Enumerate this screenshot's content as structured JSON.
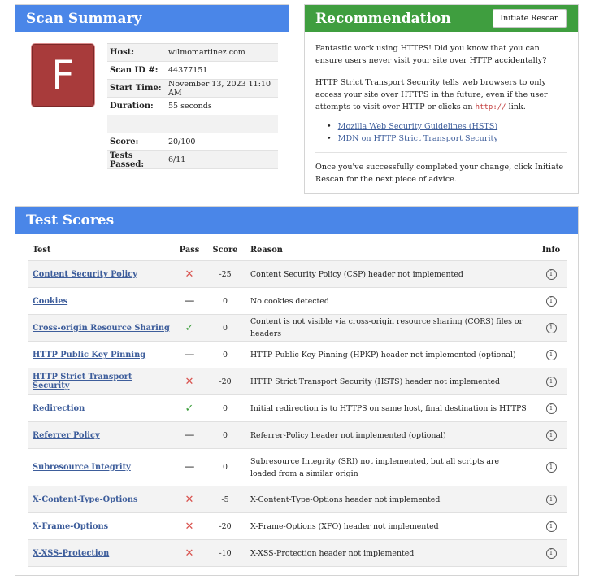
{
  "summary": {
    "title": "Scan Summary",
    "grade": "F",
    "rows": [
      {
        "label": "Host:",
        "value": "wilmomartinez.com"
      },
      {
        "label": "Scan ID #:",
        "value": "44377151"
      },
      {
        "label": "Start Time:",
        "value": "November 13, 2023 11:10 AM"
      },
      {
        "label": "Duration:",
        "value": "55 seconds"
      },
      {
        "label": "",
        "value": ""
      },
      {
        "label": "Score:",
        "value": "20/100"
      },
      {
        "label": "Tests Passed:",
        "value": "6/11"
      }
    ]
  },
  "recommendation": {
    "title": "Recommendation",
    "rescan_label": "Initiate Rescan",
    "p1": "Fantastic work using HTTPS! Did you know that you can ensure users never visit your site over HTTP accidentally?",
    "p2_before": "HTTP Strict Transport Security tells web browsers to only access your site over HTTPS in the future, even if the user attempts to visit over HTTP or clicks an ",
    "p2_code": "http://",
    "p2_after": " link.",
    "links": [
      "Mozilla Web Security Guidelines (HSTS)",
      "MDN on HTTP Strict Transport Security"
    ],
    "p3": "Once you've successfully completed your change, click Initiate Rescan for the next piece of advice."
  },
  "scores": {
    "title": "Test Scores",
    "headers": {
      "test": "Test",
      "pass": "Pass",
      "score": "Score",
      "reason": "Reason",
      "info": "Info"
    },
    "rows": [
      {
        "test": "Content Security Policy",
        "pass": "fail",
        "score": "-25",
        "reason": "Content Security Policy (CSP) header not implemented"
      },
      {
        "test": "Cookies",
        "pass": "neutral",
        "score": "0",
        "reason": "No cookies detected"
      },
      {
        "test": "Cross-origin Resource Sharing",
        "pass": "pass",
        "score": "0",
        "reason": "Content is not visible via cross-origin resource sharing (CORS) files or headers"
      },
      {
        "test": "HTTP Public Key Pinning",
        "pass": "neutral",
        "score": "0",
        "reason": "HTTP Public Key Pinning (HPKP) header not implemented (optional)"
      },
      {
        "test": "HTTP Strict Transport Security",
        "pass": "fail",
        "score": "-20",
        "reason": "HTTP Strict Transport Security (HSTS) header not implemented"
      },
      {
        "test": "Redirection",
        "pass": "pass",
        "score": "0",
        "reason": "Initial redirection is to HTTPS on same host, final destination is HTTPS"
      },
      {
        "test": "Referrer Policy",
        "pass": "neutral",
        "score": "0",
        "reason": "Referrer-Policy header not implemented (optional)"
      },
      {
        "test": "Subresource Integrity",
        "pass": "neutral",
        "score": "0",
        "reason": "Subresource Integrity (SRI) not implemented, but all scripts are loaded from a similar origin"
      },
      {
        "test": "X-Content-Type-Options",
        "pass": "fail",
        "score": "-5",
        "reason": "X-Content-Type-Options header not implemented"
      },
      {
        "test": "X-Frame-Options",
        "pass": "fail",
        "score": "-20",
        "reason": "X-Frame-Options (XFO) header not implemented"
      },
      {
        "test": "X-XSS-Protection",
        "pass": "fail",
        "score": "-10",
        "reason": "X-XSS-Protection header not implemented"
      }
    ]
  },
  "icons": {
    "fail": "cross-icon",
    "pass": "check-icon",
    "neutral": "dash-icon",
    "info": "info-icon"
  },
  "colors": {
    "summary_header": "#4a86e8",
    "recommend_header": "#3f9e3f",
    "grade_bg": "#a83b3b",
    "link": "#3d5d9b",
    "fail": "#d9534f",
    "pass": "#3c9e3c"
  }
}
